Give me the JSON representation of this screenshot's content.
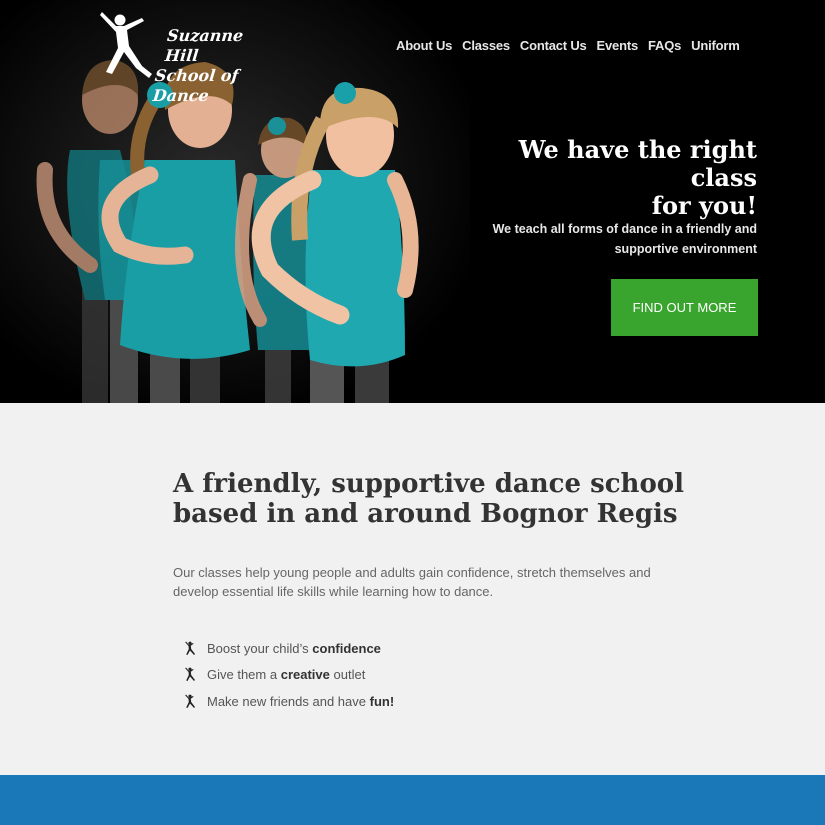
{
  "logo": {
    "line1": "Suzanne Hill",
    "line2": "School of Dance",
    "icon": "dancer-icon"
  },
  "nav": {
    "items": [
      "About Us",
      "Classes",
      "Contact Us",
      "Events",
      "FAQs",
      "Uniform"
    ]
  },
  "hero": {
    "title_line1": "We have the right class",
    "title_line2": "for you!",
    "subtitle_line1": "We teach all forms of dance in a friendly and",
    "subtitle_line2": "supportive environment",
    "cta_label": "FIND OUT MORE"
  },
  "intro": {
    "heading_line1": "A friendly, supportive dance school",
    "heading_line2": "based in and around Bognor Regis",
    "paragraph": "Our classes help young people and adults gain confidence, stretch themselves and develop essential life skills while learning how to dance.",
    "features": [
      {
        "before": "Boost your child’s ",
        "bold": "confidence",
        "after": ""
      },
      {
        "before": "Give them a ",
        "bold": "creative",
        "after": " outlet"
      },
      {
        "before": "Make new friends and have ",
        "bold": "fun!",
        "after": ""
      }
    ]
  },
  "colors": {
    "cta": "#3aa52e",
    "footer_band": "#1a78b9",
    "leotard": "#1aa0a8"
  }
}
